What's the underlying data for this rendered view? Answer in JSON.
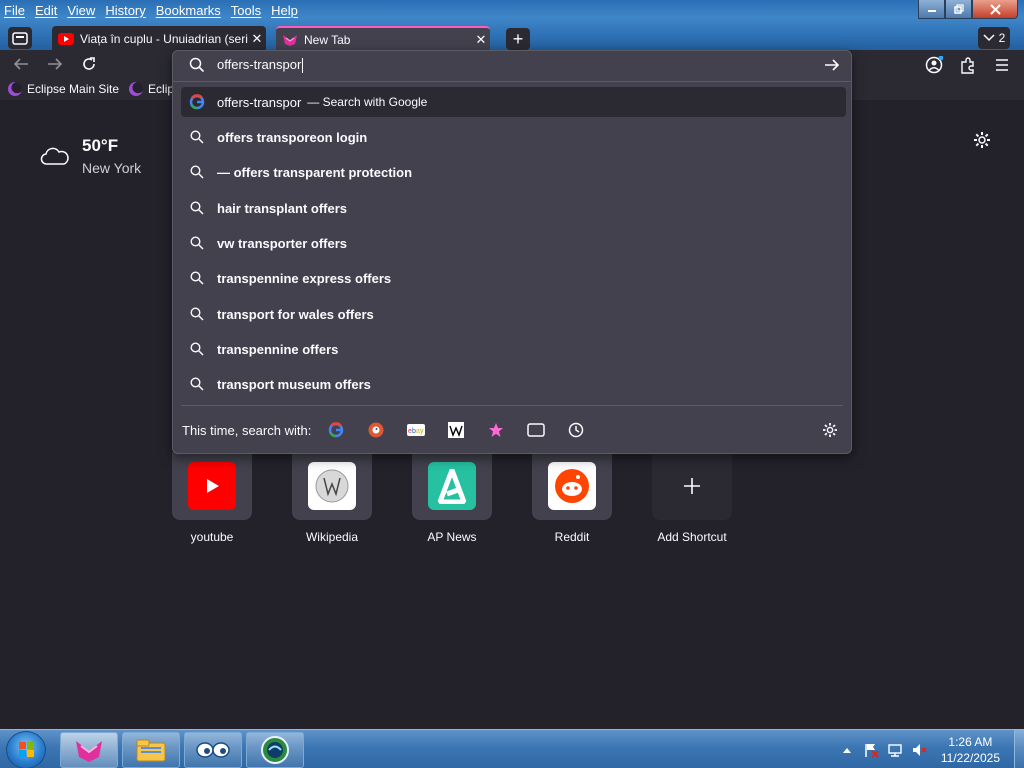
{
  "menubar": {
    "items": [
      "File",
      "Edit",
      "View",
      "History",
      "Bookmarks",
      "Tools",
      "Help"
    ]
  },
  "tabs": [
    {
      "title": "Viața în cuplu - Unuiadrian (seri",
      "close": "✕"
    },
    {
      "title": "New Tab",
      "close": "✕"
    }
  ],
  "new_tab": "+",
  "tab_count": "2",
  "bookmarks": [
    "Eclipse Main Site",
    "Eclips"
  ],
  "urlbar": {
    "value": "offers-transpor",
    "first_result": {
      "text": "offers-transpor",
      "action": "— Search with Google"
    },
    "suggestions": [
      "offers transporeon login",
      "— offers transparent protection",
      "hair transplant offers",
      "vw transporter offers",
      "transpennine express offers",
      "transport for wales offers",
      "transpennine offers",
      "transport museum offers"
    ],
    "oneoff_label": "This time, search with:",
    "oneoff_engines": [
      "google-icon",
      "duckduckgo-icon",
      "ebay-icon",
      "wikipedia-icon",
      "bookmarks-star-icon",
      "tabs-icon",
      "history-icon"
    ]
  },
  "weather": {
    "temp": "50°F",
    "city": "New York"
  },
  "shortcuts": [
    {
      "label": "youtube",
      "icon": "youtube-icon",
      "color": "#ff0000"
    },
    {
      "label": "Wikipedia",
      "icon": "wikipedia-icon",
      "color": "#ffffff"
    },
    {
      "label": "AP News",
      "icon": "ap-news-icon",
      "color": "#25c1a1"
    },
    {
      "label": "Reddit",
      "icon": "reddit-icon",
      "color": "#ff4500"
    },
    {
      "label": "Add Shortcut",
      "icon": "plus-icon",
      "color": "#42414d"
    }
  ],
  "taskbar": {
    "clock_time": "1:26 AM",
    "clock_date": "11/22/2025"
  },
  "colors": {
    "accent": "#ff5abe",
    "toolbar": "#2b2a33",
    "panel": "#42414d",
    "page": "#23222b"
  }
}
